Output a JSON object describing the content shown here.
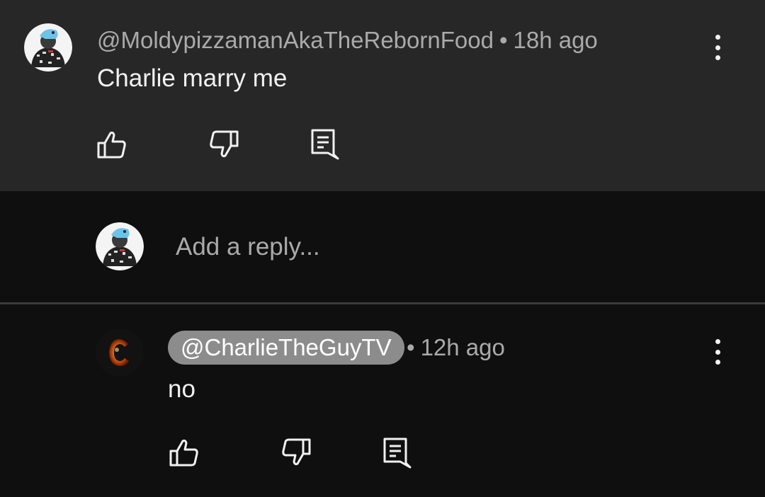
{
  "parent_comment": {
    "author": "@MoldypizzamanAkaTheRebornFood",
    "separator": "•",
    "time": "18h ago",
    "text": "Charlie marry me"
  },
  "reply_box": {
    "placeholder": "Add a reply..."
  },
  "reply_comment": {
    "author": "@CharlieTheGuyTV",
    "separator": "•",
    "time": "12h ago",
    "text": "no"
  },
  "icons": {
    "like": "thumbs-up-icon",
    "dislike": "thumbs-down-icon",
    "reply": "comment-reply-icon",
    "more": "more-vertical-icon"
  },
  "colors": {
    "parent_bg": "#272727",
    "page_bg": "#0f0f0f",
    "pill_bg": "#8c8c8c",
    "secondary_text": "#aaaaaa"
  }
}
